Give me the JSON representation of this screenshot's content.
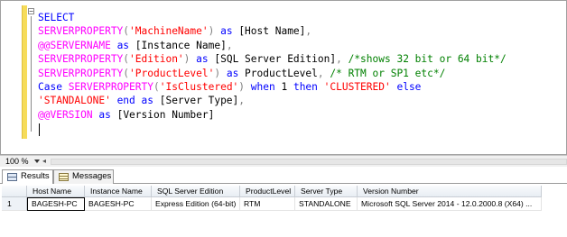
{
  "editor": {
    "lines": [
      [
        {
          "t": "SELECT",
          "c": "kw"
        }
      ],
      [
        {
          "t": "SERVERPROPERTY",
          "c": "fn"
        },
        {
          "t": "(",
          "c": "op"
        },
        {
          "t": "'MachineName'",
          "c": "str"
        },
        {
          "t": ")",
          "c": "op"
        },
        {
          "t": " as ",
          "c": "kw"
        },
        {
          "t": "[Host Name]",
          "c": ""
        },
        {
          "t": ",",
          "c": "op"
        }
      ],
      [
        {
          "t": "@@SERVERNAME",
          "c": "gv"
        },
        {
          "t": " as ",
          "c": "kw"
        },
        {
          "t": "[Instance Name]",
          "c": ""
        },
        {
          "t": ",",
          "c": "op"
        }
      ],
      [
        {
          "t": "SERVERPROPERTY",
          "c": "fn"
        },
        {
          "t": "(",
          "c": "op"
        },
        {
          "t": "'Edition'",
          "c": "str"
        },
        {
          "t": ")",
          "c": "op"
        },
        {
          "t": " as ",
          "c": "kw"
        },
        {
          "t": "[SQL Server Edition]",
          "c": ""
        },
        {
          "t": ", ",
          "c": "op"
        },
        {
          "t": "/*shows 32 bit or 64 bit*/",
          "c": "cm"
        }
      ],
      [
        {
          "t": "SERVERPROPERTY",
          "c": "fn"
        },
        {
          "t": "(",
          "c": "op"
        },
        {
          "t": "'ProductLevel'",
          "c": "str"
        },
        {
          "t": ")",
          "c": "op"
        },
        {
          "t": " as ",
          "c": "kw"
        },
        {
          "t": "ProductLevel",
          "c": ""
        },
        {
          "t": ", ",
          "c": "op"
        },
        {
          "t": "/* RTM or SP1 etc*/",
          "c": "cm"
        }
      ],
      [
        {
          "t": "Case ",
          "c": "kw"
        },
        {
          "t": "SERVERPROPERTY",
          "c": "fn"
        },
        {
          "t": "(",
          "c": "op"
        },
        {
          "t": "'IsClustered'",
          "c": "str"
        },
        {
          "t": ")",
          "c": "op"
        },
        {
          "t": " when ",
          "c": "kw"
        },
        {
          "t": "1",
          "c": ""
        },
        {
          "t": " then ",
          "c": "kw"
        },
        {
          "t": "'CLUSTERED'",
          "c": "str"
        },
        {
          "t": " else",
          "c": "kw"
        }
      ],
      [
        {
          "t": "'STANDALONE'",
          "c": "str"
        },
        {
          "t": " end as ",
          "c": "kw"
        },
        {
          "t": "[Server Type]",
          "c": ""
        },
        {
          "t": ",",
          "c": "op"
        }
      ],
      [
        {
          "t": "@@VERSION",
          "c": "gv"
        },
        {
          "t": " as ",
          "c": "kw"
        },
        {
          "t": "[Version Number]",
          "c": ""
        }
      ]
    ]
  },
  "zoom": {
    "value": "100 %"
  },
  "tabs": {
    "results": "Results",
    "messages": "Messages"
  },
  "grid": {
    "columns": [
      "Host Name",
      "Instance Name",
      "SQL Server Edition",
      "ProductLevel",
      "Server Type",
      "Version Number"
    ],
    "rows": [
      {
        "num": "1",
        "cells": [
          "BAGESH-PC",
          "BAGESH-PC",
          "Express Edition (64-bit)",
          "RTM",
          "STANDALONE",
          "Microsoft SQL Server 2014 - 12.0.2000.8 (X64)   ..."
        ]
      }
    ]
  },
  "colors": {
    "keyword": "#0000ff",
    "function": "#ff00ff",
    "string": "#ff0000",
    "comment": "#008000",
    "operator": "#808080",
    "change_bar": "#f6dc5a"
  }
}
